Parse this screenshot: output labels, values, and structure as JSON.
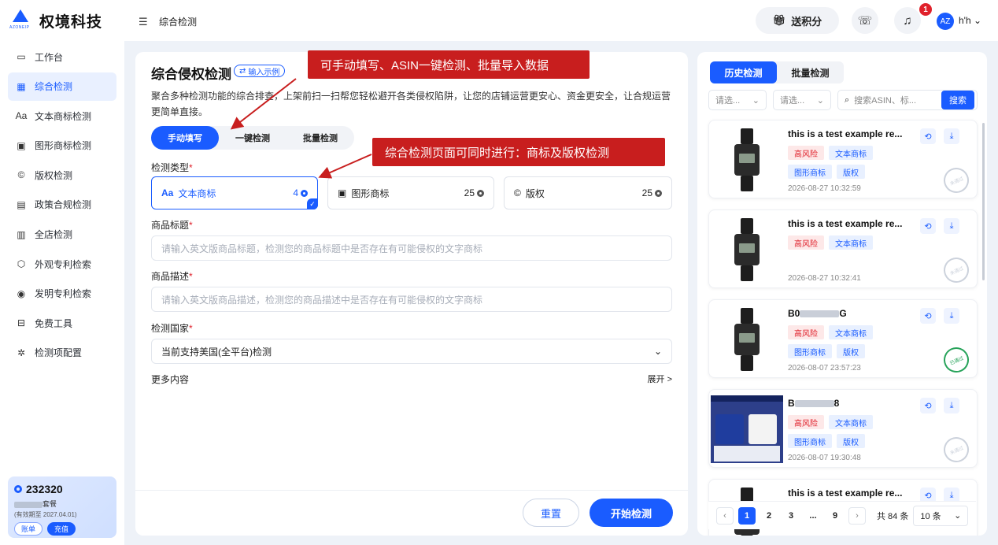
{
  "brand": {
    "name": "权境科技",
    "logo_sub": "AZONEIP"
  },
  "nav": {
    "items": [
      {
        "label": "工作台",
        "icon": "monitor-icon"
      },
      {
        "label": "综合检测",
        "icon": "grid-icon"
      },
      {
        "label": "文本商标检测",
        "icon": "text-icon"
      },
      {
        "label": "图形商标检测",
        "icon": "image-icon"
      },
      {
        "label": "版权检测",
        "icon": "copyright-icon"
      },
      {
        "label": "政策合规检测",
        "icon": "policy-icon"
      },
      {
        "label": "全店检测",
        "icon": "store-icon"
      },
      {
        "label": "外观专利检索",
        "icon": "cube-icon"
      },
      {
        "label": "发明专利检索",
        "icon": "bulb-icon"
      },
      {
        "label": "免费工具",
        "icon": "toolbox-icon"
      },
      {
        "label": "检测项配置",
        "icon": "settings-icon"
      }
    ],
    "active_index": 1
  },
  "account": {
    "points": "232320",
    "plan_suffix": "套餐",
    "expiry": "(有效期至 2027.04.01)",
    "bill_label": "账单",
    "recharge_label": "充值"
  },
  "topbar": {
    "page_title": "综合检测",
    "points_label": "送积分",
    "notify_count": "1",
    "user_name": "h'h",
    "avatar_text": "AZ"
  },
  "main": {
    "title": "综合侵权检测",
    "example_label": "输入示例",
    "description": "聚合多种检测功能的综合排查，上架前扫一扫帮您轻松避开各类侵权陷阱，让您的店铺运营更安心、资金更安全，让合规运营更简单直接。",
    "mode_tabs": [
      "手动填写",
      "一键检测",
      "批量检测"
    ],
    "active_mode": 0,
    "type_label": "检测类型",
    "types": [
      {
        "label": "文本商标",
        "count": "4",
        "icon": "text-icon"
      },
      {
        "label": "图形商标",
        "count": "25",
        "icon": "image-icon"
      },
      {
        "label": "版权",
        "count": "25",
        "icon": "copyright-icon"
      }
    ],
    "title_label": "商品标题",
    "title_placeholder": "请输入英文版商品标题，检测您的商品标题中是否存在有可能侵权的文字商标",
    "desc_label": "商品描述",
    "desc_placeholder": "请输入英文版商品描述，检测您的商品描述中是否存在有可能侵权的文字商标",
    "country_label": "检测国家",
    "country_value": "当前支持美国(全平台)检测",
    "more_label": "更多内容",
    "expand_label": "展开 >",
    "reset_label": "重置",
    "start_label": "开始检测"
  },
  "callouts": {
    "top": "可手动填写、ASIN一键检测、批量导入数据",
    "mid": "综合检测页面可同时进行：商标及版权检测"
  },
  "history": {
    "tabs": [
      "历史检测",
      "批量检测"
    ],
    "filter1": "请选...",
    "filter2": "请选...",
    "search_placeholder": "搜索ASIN、标...",
    "search_btn": "搜索",
    "records": [
      {
        "title": "this is a test example re...",
        "tags": [
          "高风险",
          "文本商标",
          "图形商标",
          "版权"
        ],
        "time": "2026-08-27 10:32:59",
        "stamp": "未通过",
        "img": "watch"
      },
      {
        "title": "this is a test example re...",
        "tags": [
          "高风险",
          "文本商标"
        ],
        "time": "2026-08-27 10:32:41",
        "stamp": "未通过",
        "img": "watch"
      },
      {
        "title": "B0",
        "title_suffix": "G",
        "tags": [
          "高风险",
          "文本商标",
          "图形商标",
          "版权"
        ],
        "time": "2026-08-07 23:57:23",
        "stamp": "已通过",
        "img": "watch"
      },
      {
        "title": "B",
        "title_suffix": "8",
        "tags": [
          "高风险",
          "文本商标",
          "图形商标",
          "版权"
        ],
        "time": "2026-08-07 19:30:48",
        "stamp": "未通过",
        "img": "tshirt"
      },
      {
        "title": "this is a test example re...",
        "tags": [],
        "time": "",
        "stamp": "",
        "img": "watch"
      }
    ],
    "pager": {
      "pages": [
        "1",
        "2",
        "3",
        "...",
        "9"
      ],
      "current": "1",
      "total": "共 84 条",
      "size": "10 条"
    }
  },
  "colors": {
    "accent": "#1a5cff",
    "danger": "#e0212b",
    "callout": "#c81e1e"
  }
}
